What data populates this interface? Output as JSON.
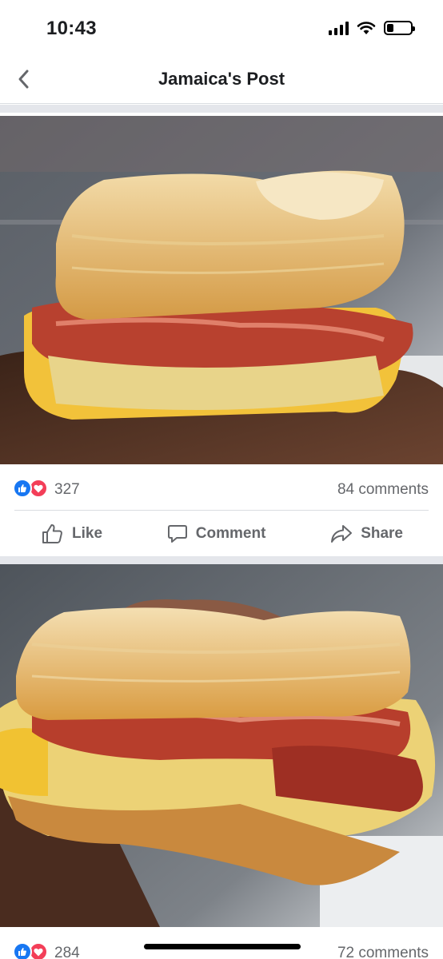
{
  "status_bar": {
    "time": "10:43",
    "icons": [
      "cellular-signal-icon",
      "wifi-icon",
      "battery-icon"
    ],
    "battery_level": 0.3
  },
  "nav": {
    "back_icon": "chevron-left-icon",
    "title": "Jamaica's Post"
  },
  "posts": [
    {
      "photo": "photo of a breakfast sandwich with bacon, egg and cheese on a croissant held in a hand",
      "reaction_icons": [
        "like-icon",
        "love-icon"
      ],
      "reaction_count": "327",
      "comments": "84 comments",
      "actions": [
        {
          "icon": "thumbs-up-icon",
          "label": "Like"
        },
        {
          "icon": "comment-icon",
          "label": "Comment"
        },
        {
          "icon": "share-icon",
          "label": "Share"
        }
      ]
    },
    {
      "photo": "close-up photo of a bitten breakfast sandwich with bacon, egg and cheese",
      "reaction_icons": [
        "like-icon",
        "love-icon"
      ],
      "reaction_count": "284",
      "comments": "72 comments"
    }
  ],
  "colors": {
    "like_blue": "#1877f2",
    "love_red": "#f33e58",
    "secondary_text": "#65676b",
    "divider": "#e4e6eb"
  }
}
